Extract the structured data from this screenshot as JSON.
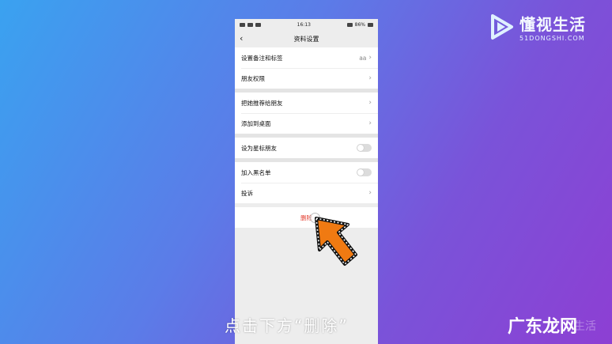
{
  "status_bar": {
    "time": "16:13",
    "battery": "86%"
  },
  "nav": {
    "title": "资料设置"
  },
  "groups": [
    {
      "rows": [
        {
          "label": "设置备注和标签",
          "value": "aa"
        },
        {
          "label": "朋友权限"
        }
      ]
    },
    {
      "rows": [
        {
          "label": "把她推荐给朋友"
        },
        {
          "label": "添加到桌面"
        }
      ]
    },
    {
      "rows": [
        {
          "label": "设为星标朋友",
          "toggle": false
        }
      ]
    },
    {
      "rows": [
        {
          "label": "加入黑名单",
          "toggle": false
        },
        {
          "label": "投诉"
        }
      ]
    }
  ],
  "delete": {
    "label": "删除"
  },
  "logo": {
    "cn": "懂视生活",
    "en": "51DONGSHI.COM"
  },
  "caption": "点击下方“删除”",
  "watermark": "广东龙网",
  "watermark_faint": "生活",
  "colors": {
    "delete_red": "#e33b2d",
    "arrow_orange": "#f07a12"
  }
}
